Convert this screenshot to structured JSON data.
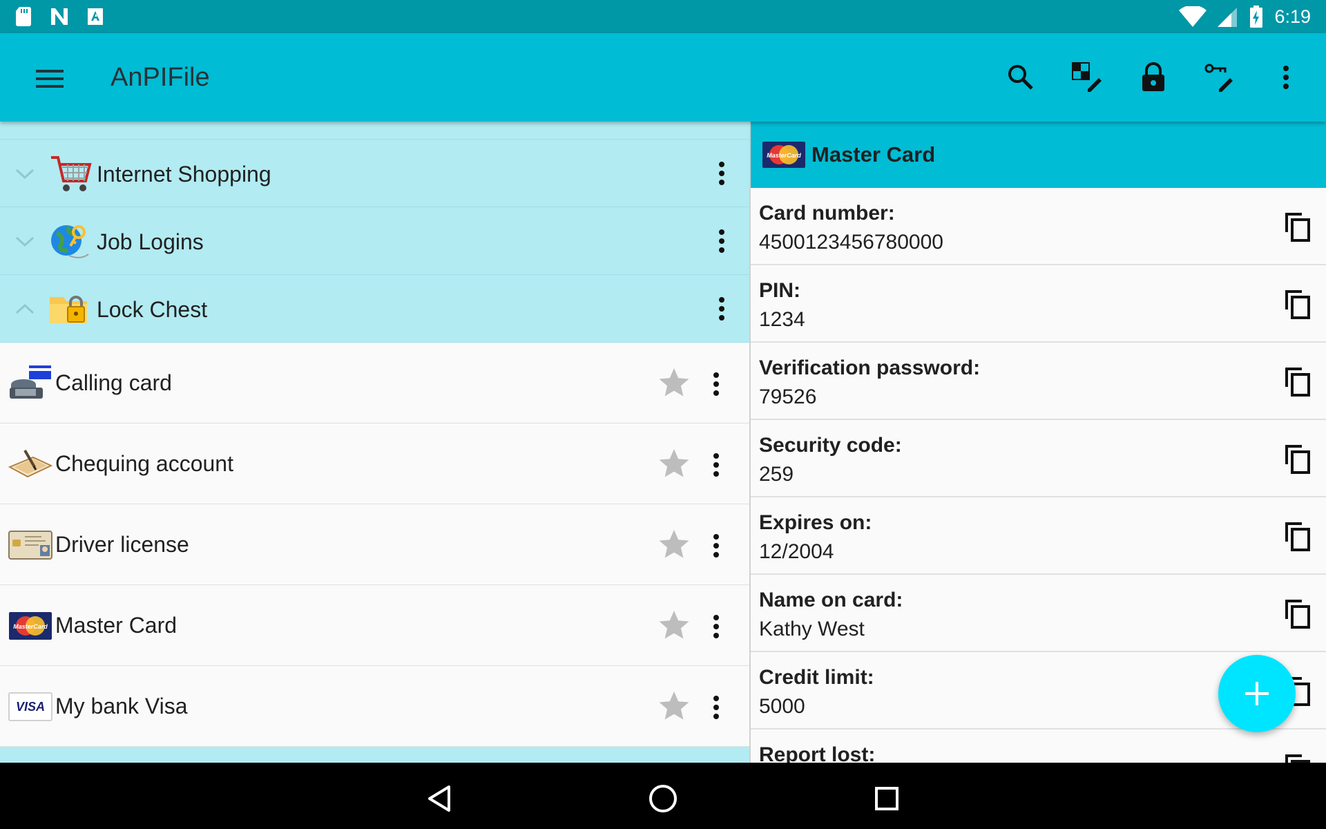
{
  "status_bar": {
    "time": "6:19",
    "left_icons": [
      "sd-card-icon",
      "n-icon",
      "a-icon"
    ],
    "right_icons": [
      "wifi-icon",
      "signal-icon",
      "battery-charging-icon"
    ]
  },
  "app_bar": {
    "title": "AnPIFile",
    "actions": [
      "search-icon",
      "edit-grid-icon",
      "lock-icon",
      "key-edit-icon",
      "more-vert-icon"
    ],
    "background": "#00bcd4"
  },
  "groups": [
    {
      "label": "Internet Shopping",
      "icon": "shopping-cart-icon",
      "expanded": false
    },
    {
      "label": "Job Logins",
      "icon": "globe-key-icon",
      "expanded": false
    },
    {
      "label": "Lock Chest",
      "icon": "locked-folder-icon",
      "expanded": true
    }
  ],
  "items": [
    {
      "label": "Calling card",
      "icon": "phone-card-icon"
    },
    {
      "label": "Chequing account",
      "icon": "cheque-pen-icon"
    },
    {
      "label": "Driver license",
      "icon": "license-card-icon"
    },
    {
      "label": "Master Card",
      "icon": "mastercard-icon"
    },
    {
      "label": "My bank Visa",
      "icon": "visa-icon"
    }
  ],
  "detail": {
    "title": "Master Card",
    "fields": [
      {
        "label": "Card number:",
        "value": "4500123456780000"
      },
      {
        "label": "PIN:",
        "value": "1234"
      },
      {
        "label": "Verification password:",
        "value": "79526"
      },
      {
        "label": "Security code:",
        "value": "259"
      },
      {
        "label": "Expires on:",
        "value": "12/2004"
      },
      {
        "label": "Name on card:",
        "value": "Kathy West"
      },
      {
        "label": "Credit limit:",
        "value": "5000"
      },
      {
        "label": "Report lost:",
        "value": ""
      }
    ]
  },
  "brand": {
    "mastercard_label": "MasterCard",
    "visa_label": "VISA"
  },
  "colors": {
    "accent": "#00bcd4",
    "status": "#0097a7",
    "group_bg": "#b2ebf2",
    "fab": "#00e5ff"
  }
}
